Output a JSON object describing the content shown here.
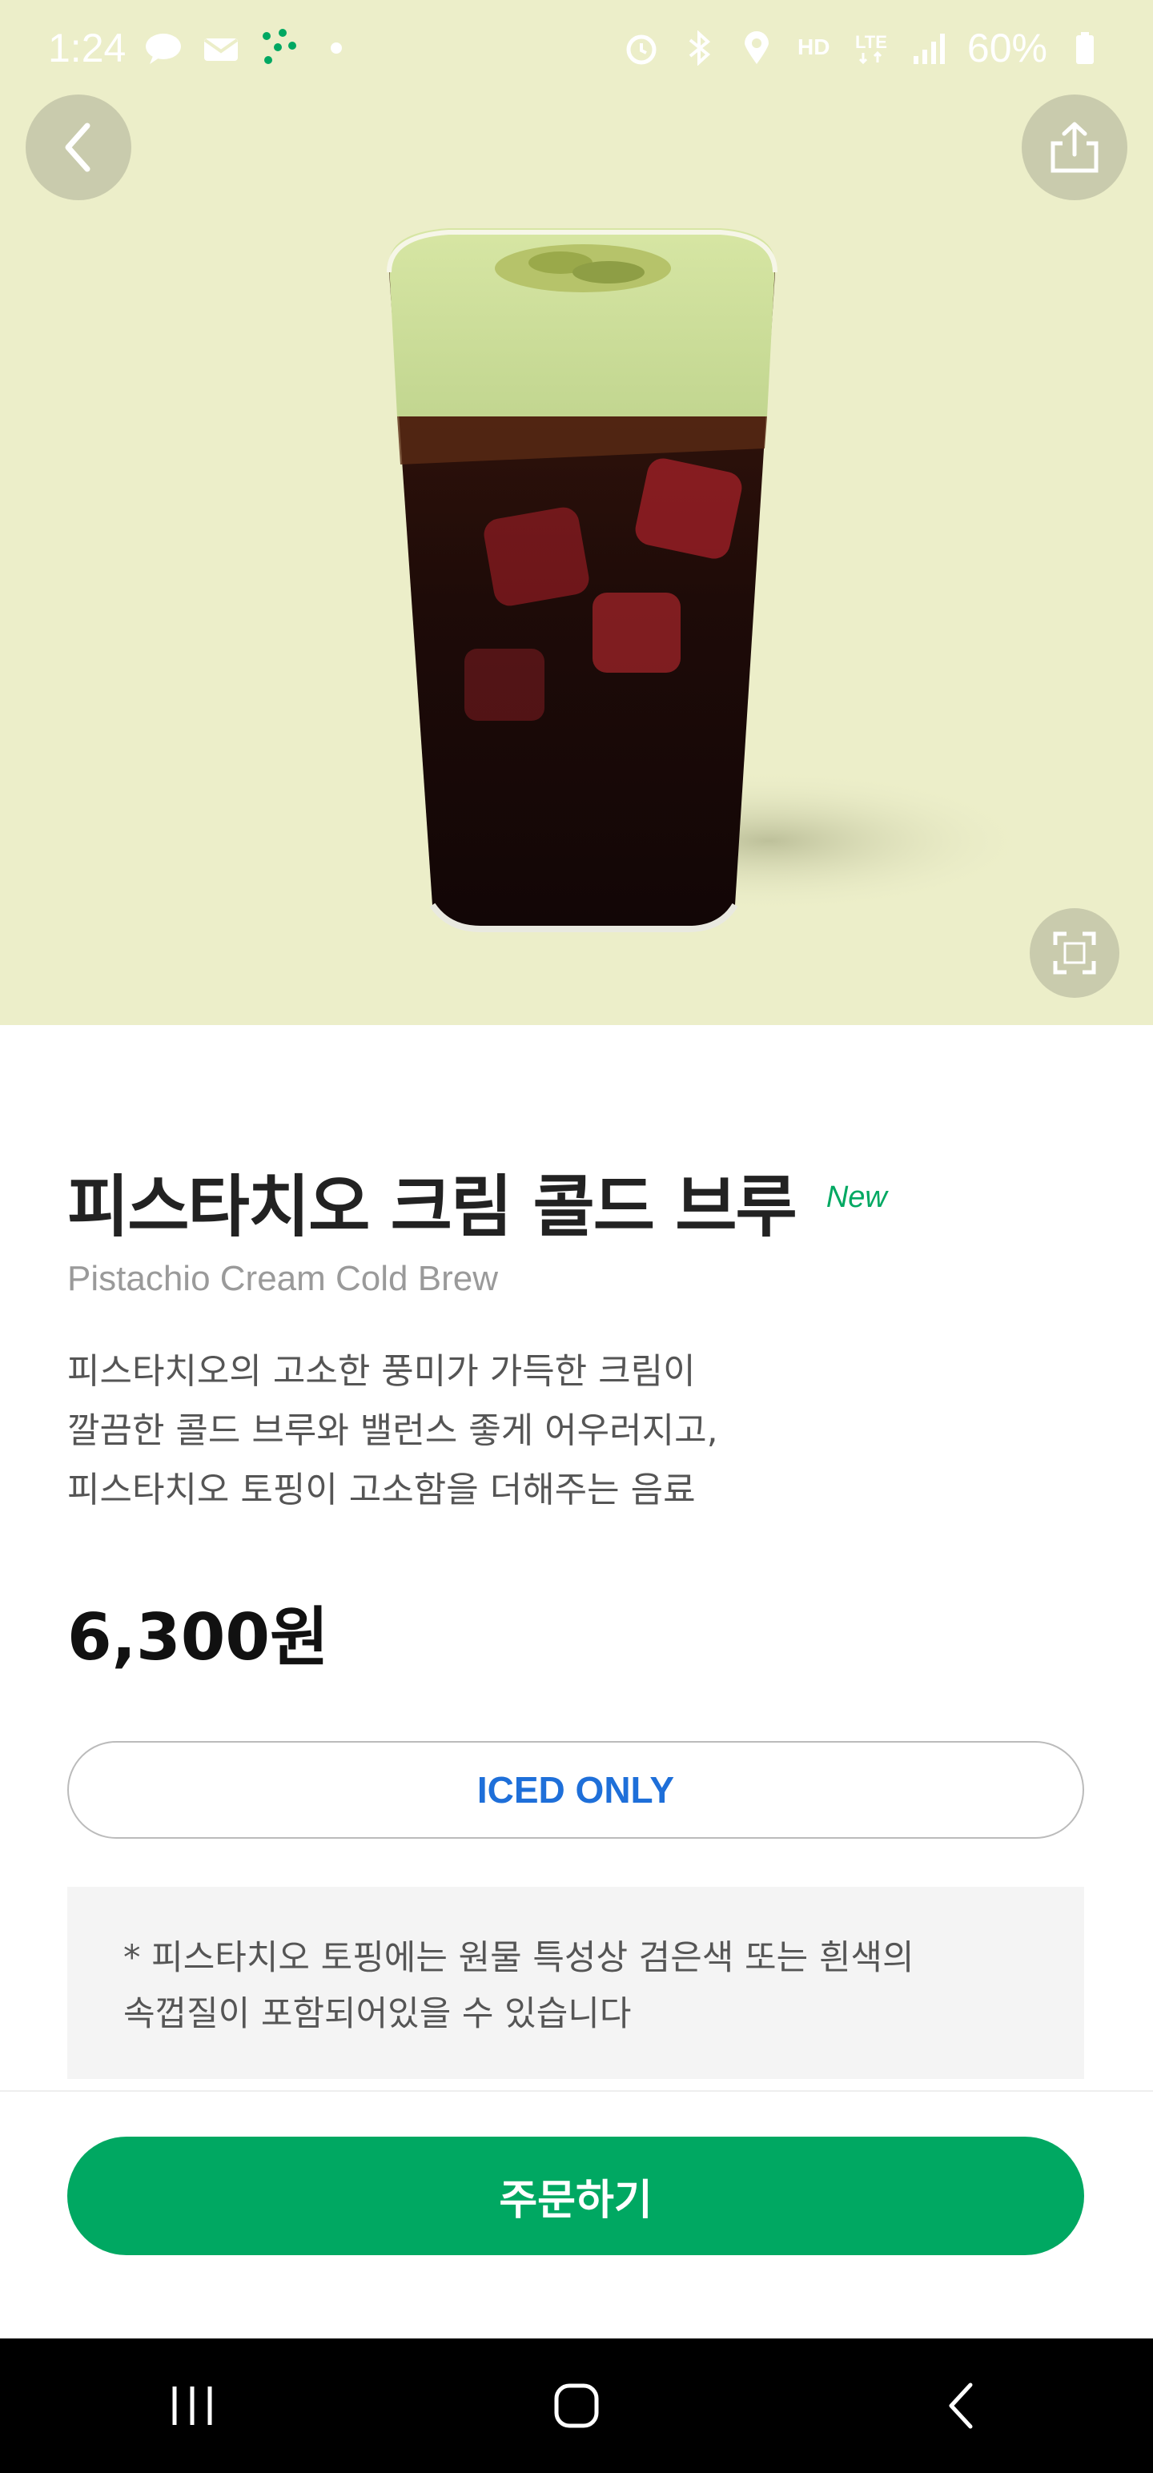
{
  "status_bar": {
    "time": "1:24",
    "battery": "60%",
    "left_icons": [
      "chat-bubble-icon",
      "mail-icon",
      "dots-app-icon",
      "dot-icon"
    ],
    "right_icons": [
      "alarm-icon",
      "bluetooth-icon",
      "location-icon",
      "hd-voice-icon",
      "lte-icon",
      "signal-icon",
      "battery-icon"
    ]
  },
  "hero": {
    "background_color": "#eceec9",
    "back_icon": "chevron-left-icon",
    "share_icon": "share-icon",
    "expand_icon": "expand-icon"
  },
  "product": {
    "name": "피스타치오 크림 콜드 브루",
    "badge": "New",
    "english_name": "Pistachio Cream Cold Brew",
    "description_lines": [
      "피스타치오의 고소한 풍미가 가득한 크림이",
      "깔끔한 콜드 브루와 밸런스 좋게 어우러지고,",
      "피스타치오 토핑이 고소함을 더해주는 음료"
    ],
    "price": "6,300원",
    "temperature_option": "ICED ONLY",
    "notice_lines": [
      "* 피스타치오 토핑에는 원물 특성상 검은색 또는 흰색의",
      "속껍질이 포함되어있을 수 있습니다"
    ]
  },
  "actions": {
    "order_label": "주문하기"
  },
  "colors": {
    "brand_green": "#00a862",
    "option_blue": "#1e6fd9"
  },
  "nav_bar": {
    "items": [
      "recent-apps-icon",
      "home-icon",
      "back-icon"
    ]
  }
}
